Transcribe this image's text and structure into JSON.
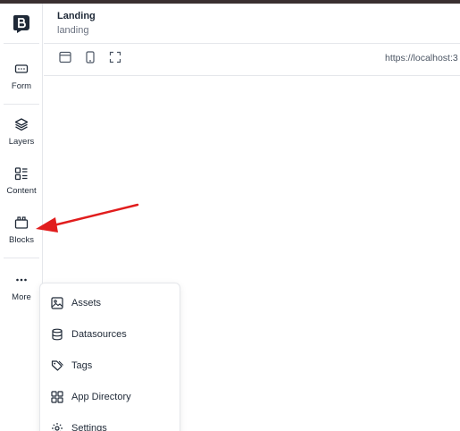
{
  "colors": {
    "top_strip": "#3a2f30",
    "icon": "#1f2937",
    "annotation_arrow": "#e11d1d"
  },
  "header": {
    "title": "Landing",
    "slug": "landing"
  },
  "toolbar": {
    "url": "https://localhost:3"
  },
  "sidebar": {
    "logo_icon": "brand-b-icon",
    "items": [
      {
        "label": "Form",
        "icon": "form-icon"
      },
      {
        "label": "Layers",
        "icon": "layers-icon"
      },
      {
        "label": "Content",
        "icon": "content-icon"
      },
      {
        "label": "Blocks",
        "icon": "blocks-icon"
      },
      {
        "label": "More",
        "icon": "more-icon"
      }
    ]
  },
  "more_menu": {
    "items": [
      {
        "label": "Assets",
        "icon": "image-icon"
      },
      {
        "label": "Datasources",
        "icon": "database-icon"
      },
      {
        "label": "Tags",
        "icon": "tags-icon"
      },
      {
        "label": "App Directory",
        "icon": "grid-icon"
      },
      {
        "label": "Settings",
        "icon": "gear-icon"
      }
    ]
  }
}
